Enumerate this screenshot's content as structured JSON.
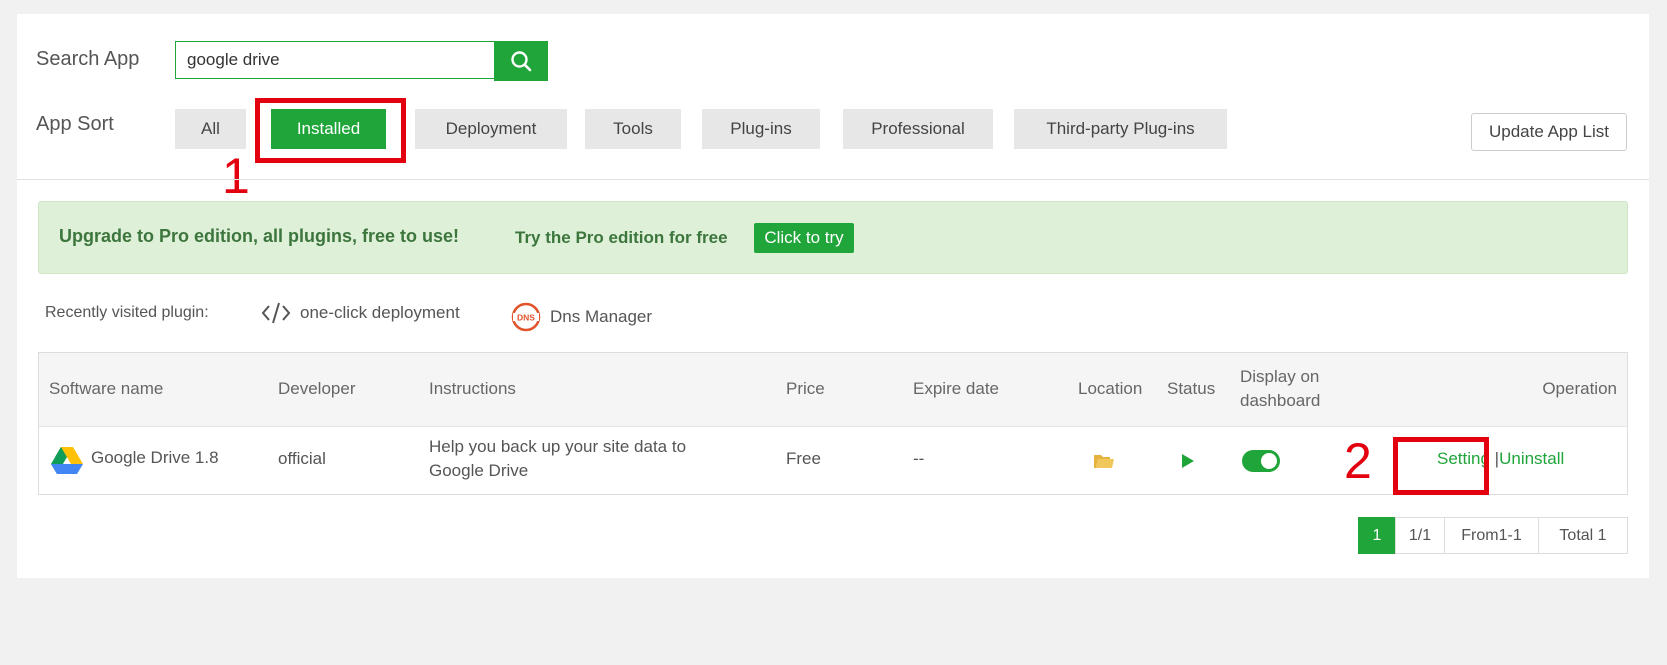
{
  "search": {
    "label": "Search App",
    "value": "google drive",
    "placeholder": "",
    "button_icon": "search-icon"
  },
  "sort": {
    "label": "App Sort",
    "items": [
      "All",
      "Installed",
      "Deployment",
      "Tools",
      "Plug-ins",
      "Professional",
      "Third-party Plug-ins"
    ],
    "active": "Installed"
  },
  "update_label": "Update App List",
  "annotations": {
    "marker_1": "1",
    "marker_2": "2",
    "color": "#e3000f"
  },
  "promo": {
    "main": "Upgrade to Pro edition, all plugins, free to use!",
    "sub": "Try the Pro edition for free",
    "button": "Click to try"
  },
  "recent": {
    "label": "Recently visited plugin:",
    "items": [
      {
        "icon": "code-icon",
        "label": "one-click deployment"
      },
      {
        "icon": "dns-icon",
        "label": "Dns Manager"
      }
    ]
  },
  "table": {
    "headers": {
      "software_name": "Software name",
      "developer": "Developer",
      "instructions": "Instructions",
      "price": "Price",
      "expire": "Expire date",
      "location": "Location",
      "status": "Status",
      "display_line1": "Display on",
      "display_line2": "dashboard",
      "operation": "Operation"
    },
    "rows": [
      {
        "icon": "google-drive-icon",
        "name": "Google Drive 1.8",
        "developer": "official",
        "instructions_line1": "Help you back up your site data to",
        "instructions_line2": "Google Drive",
        "price": "Free",
        "expire": "--",
        "location_icon": "folder-icon",
        "status_icon": "play-icon",
        "display_on": true,
        "setting": "Setting",
        "separator": "|",
        "uninstall": "Uninstall"
      }
    ]
  },
  "pagination": {
    "current": "1",
    "pages": "1/1",
    "range": "From1-1",
    "total": "Total 1"
  },
  "colors": {
    "accent": "#20a53a",
    "promo_bg": "#dff0d8",
    "promo_text": "#3c763d"
  }
}
